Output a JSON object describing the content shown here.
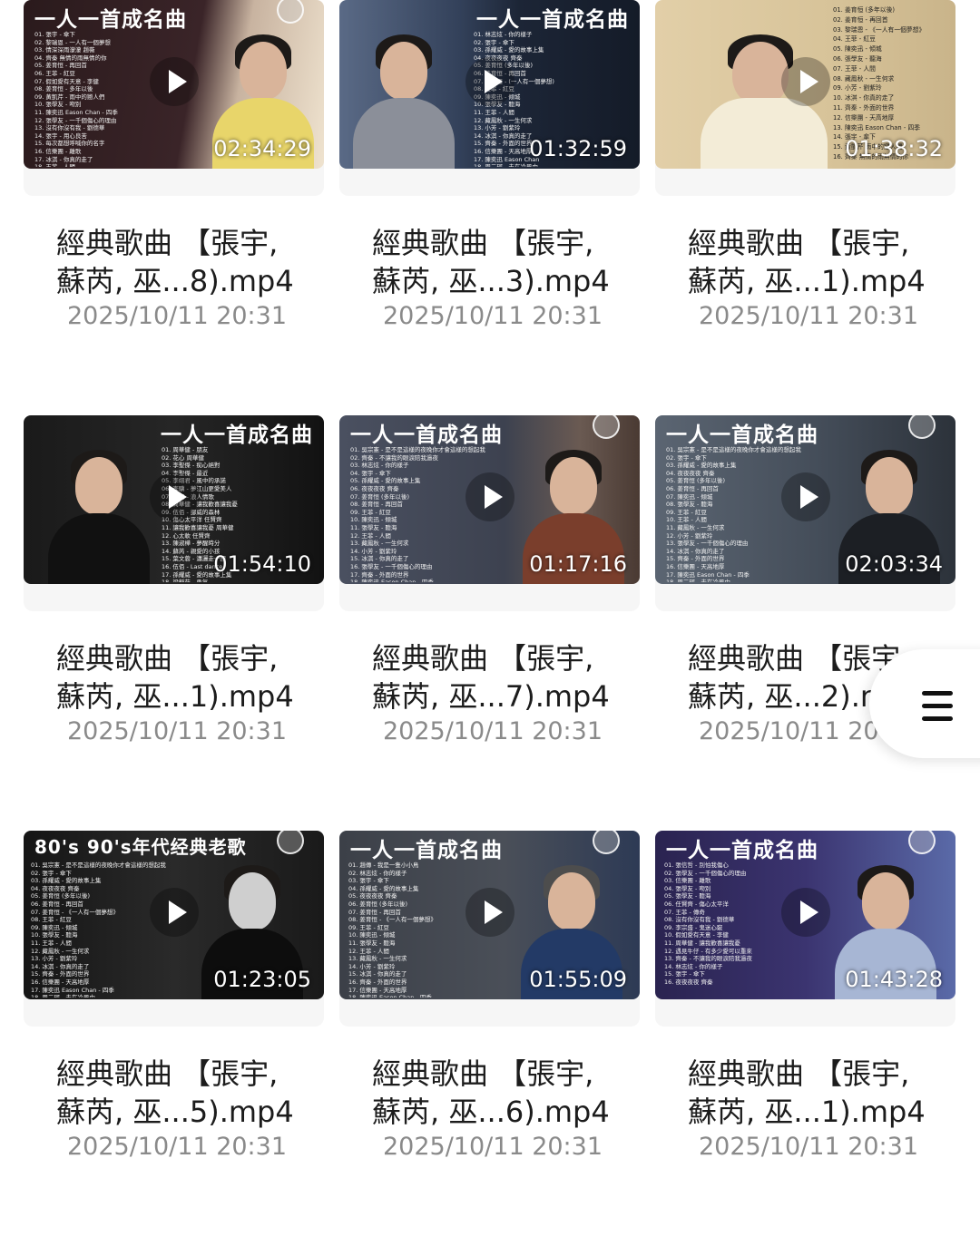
{
  "videos": [
    {
      "thumb_title": "一人一首成名曲",
      "duration": "02:34:29",
      "name_line1": "經典歌曲 【張宇,",
      "name_line2": "蘇芮, 巫...8).mp4",
      "date": "2025/10/11 20:31"
    },
    {
      "thumb_title": "一人一首成名曲",
      "duration": "01:32:59",
      "name_line1": "經典歌曲 【張宇,",
      "name_line2": "蘇芮, 巫...3).mp4",
      "date": "2025/10/11 20:31"
    },
    {
      "thumb_title": "",
      "duration": "01:38:32",
      "name_line1": "經典歌曲 【張宇,",
      "name_line2": "蘇芮, 巫...1).mp4",
      "date": "2025/10/11 20:31"
    },
    {
      "thumb_title": "一人一首成名曲",
      "duration": "01:54:10",
      "name_line1": "經典歌曲 【張宇,",
      "name_line2": "蘇芮, 巫...1).mp4",
      "date": "2025/10/11 20:31"
    },
    {
      "thumb_title": "一人一首成名曲",
      "duration": "01:17:16",
      "name_line1": "經典歌曲 【張宇,",
      "name_line2": "蘇芮, 巫...7).mp4",
      "date": "2025/10/11 20:31"
    },
    {
      "thumb_title": "一人一首成名曲",
      "duration": "02:03:34",
      "name_line1": "經典歌曲 【張宇",
      "name_line2": "蘇芮, 巫...2).m",
      "date": "2025/10/11 20"
    },
    {
      "thumb_title": "80's 90's年代经典老歌",
      "duration": "01:23:05",
      "name_line1": "經典歌曲 【張宇,",
      "name_line2": "蘇芮, 巫...5).mp4",
      "date": "2025/10/11 20:31"
    },
    {
      "thumb_title": "一人一首成名曲",
      "duration": "01:55:09",
      "name_line1": "經典歌曲 【張宇,",
      "name_line2": "蘇芮, 巫...6).mp4",
      "date": "2025/10/11 20:31"
    },
    {
      "thumb_title": "一人一首成名曲",
      "duration": "01:43:28",
      "name_line1": "經典歌曲 【張宇,",
      "name_line2": "蘇芮, 巫...1).mp4",
      "date": "2025/10/11 20:31"
    }
  ],
  "tracklists": {
    "t1": "01. 張宇 - 傘下\n02. 黎瑞恩 - 一人有一個夢想\n03. 情深深雨濛濛 趙薇\n04. 齊秦 無情的雨無情的你\n05. 姜育恒 - 再回首\n06. 王菲 - 紅豆\n07. 假如愛有天意 - 李健\n08. 姜育恒 - 多年以後\n09. 黃凱芹 - 雨中的戀人們\n10. 張學友 - 吻別\n11. 陳奕迅 Eason Chan - 四季\n12. 張學友 - 一千個傷心的理由\n13. 沒有你沒有我 - 劉德華\n14. 張宇 - 用心良苦\n15. 每次都想呼喊你的名字\n16. 信樂團 - 離歌\n17. 冰淇 - 你真的走了\n18. 王菲 - 人間",
    "t2": "01. 林志炫 - 你的樣子\n02. 張宇 - 傘下\n03. 孫耀威 - 愛的故事上集\n04. 夜夜夜夜 齊秦\n05. 姜育恒 (多年以後)\n06. 姜育恒 - 再回首\n07. 姜育恒 - (一人有一個夢想)\n08. 王菲 - 紅豆\n09. 陳奕迅 - 傾城\n10. 張學友 - 聽海\n11. 王菲 - 人間\n12. 藏鳳秋 - 一生何求\n13. 小芳 - 劉紫玲\n14. 冰淇 - 你真的走了\n15. 齊秦 - 外面的世界\n16. 信樂團 - 天高地厚\n17. 陳奕迅 Eason Chan\n18. 周二珂 - 走在冷風中\n19. 齊秦 - 外面的世界\n20. 齊秦 無情的雨無情的你",
    "t3": "01. 姜育恒 (多年以後)\n02. 姜育恒 - 再回首\n03. 黎瑞恩 - 《一人有一個夢想》\n04. 王菲 - 紅豆\n05. 陳奕迅 - 傾城\n06. 張學友 - 聽海\n07. 王菲 - 人間\n08. 藏鳳秋 - 一生何求\n09. 小芳 - 劉紫玲\n10. 冰淇 - 你真的走了\n11. 齊秦 - 外面的世界\n12. 信樂團 - 天高地厚\n13. 陳奕迅 Eason Chan - 四季\n14. 張宇 - 傘下\n15. 黃凱芹 雨中的戀人們\n16. 齊秦 無情的雨無情的你",
    "t4": "01. 周華健 - 朋友\n02. 花心 周華健\n03. 李聖傑 - 痴心絕對\n04. 李聖傑 - 最近\n05. 李翊君 - 風中的承諾\n06. 李驥 - 夢江山更愛美人\n07. 伍佰 - 浪人情歌\n08. 周華健 - 讓我歡喜讓我憂\n09. 伍佰 - 挪威的森林\n10. 傷心太平洋 任賢齊\n11. 讓我歡喜讓我憂 周華健\n12. 心太軟 任賢齊\n13. 陳淑樺 - 夢醒時分\n14. 蘇芮 - 親愛的小孩\n15. 葉文蓉 - 瀟灑走一回\n16. 伍佰 - Last dance\n17. 孫耀威 - 愛的故事上集\n18. 梁靜茹 - 勇氣\n19. 任賢齊 - 天涯",
    "t5": "01. 吳宗憲 - 是不是這樣的夜晚你才會這樣的想起我\n02. 齊秦 - 不讓我的眼淚陪我過夜\n03. 林志炫 - 你的樣子\n04. 張宇 - 傘下\n05. 孫耀威 - 愛的故事上集\n06. 夜夜夜夜 齊秦\n07. 姜育恒 (多年以後)\n08. 姜育恒 - 再回首\n09. 王菲 - 紅豆\n10. 陳奕迅 - 傾城\n11. 張學友 - 聽海\n12. 王菲 - 人間\n13. 藏鳳秋 - 一生何求\n14. 小芳 - 劉紫玲\n15. 冰淇 - 你真的走了\n16. 張學友 - 一千個傷心的理由\n17. 齊秦 - 外面的世界\n18. 陳奕迅 Eason Chan - 四季\n19. 周二珂 - 走在冷風中\n20. 黃凱芹 雨中的戀人們",
    "t6": "01. 吳宗憲 - 是不是這樣的夜晚你才會這樣的想起我\n02. 張宇 - 傘下\n03. 孫耀威 - 愛的故事上集\n04. 夜夜夜夜 齊秦\n05. 姜育恒 (多年以後)\n06. 姜育恒 - 再回首\n07. 陳奕迅 - 傾城\n08. 張學友 - 聽海\n09. 王菲 - 紅豆\n10. 王菲 - 人間\n11. 藏鳳秋 - 一生何求\n12. 小芳 - 劉紫玲\n13. 張學友 - 一千個傷心的理由\n14. 冰淇 - 你真的走了\n15. 齊秦 - 外面的世界\n16. 信樂團 - 天高地厚\n17. 陳奕迅 Eason Chan - 四季\n18. 周二珂 - 走在冷風中\n19. 齊秦 無情的雨無情的你\n20. 情深深雨濛濛 趙薇",
    "t7": "01. 吳宗憲 - 是不是這樣的夜晚你才會這樣的想起我\n02. 張宇 - 傘下\n03. 孫耀威 - 愛的故事上集\n04. 夜夜夜夜 齊秦\n05. 姜育恒 (多年以後)\n06. 姜育恒 - 再回首\n07. 姜育恒 - 《一人有一個夢想》\n08. 王菲 - 紅豆\n09. 陳奕迅 - 傾城\n10. 張學友 - 聽海\n11. 王菲 - 人間\n12. 藏鳳秋 - 一生何求\n13. 小芳 - 劉紫玲\n14. 冰淇 - 你真的走了\n15. 齊秦 - 外面的世界\n16. 信樂團 - 天高地厚\n17. 陳奕迅 Eason Chan - 四季\n18. 周二珂 - 走在冷風中\n19. 黃凱芹 雨中的戀人們\n20. 齊秦 無情的雨無情的你",
    "t8": "01. 趙傳 - 我是一隻小小鳥\n02. 林志炫 - 你的樣子\n03. 張宇 - 傘下\n04. 孫耀威 - 愛的故事上集\n05. 夜夜夜夜 齊秦\n06. 姜育恒 (多年以後)\n07. 姜育恒 - 再回首\n08. 姜育恒 - 《一人有一個夢想》\n09. 王菲 - 紅豆\n10. 陳奕迅 - 傾城\n11. 張學友 - 聽海\n12. 王菲 - 人間\n13. 藏鳳秋 - 一生何求\n14. 小芳 - 劉紫玲\n15. 冰淇 - 你真的走了\n16. 齊秦 - 外面的世界\n17. 信樂團 - 天高地厚\n18. 陳奕迅 Eason Chan - 四季\n19. 周二珂 - 走在冷風中\n20. 黃凱芹 雨中的戀人們",
    "t9": "01. 張信哲 - 別怕我傷心\n02. 張學友 - 一千個傷心的理由\n03. 信樂團 - 離歌\n04. 張學友 - 吻別\n05. 張學友 - 聽海\n06. 任賢齊 - 傷心太平洋\n07. 王菲 - 傳奇\n08. 沒有你沒有我 - 劉德華\n09. 李宗盛 - 鬼迷心竅\n10. 假如愛有天意 - 李健\n11. 周華健 - 讓我歡喜讓我憂\n12. 遇見牛仔 - 有多少愛可以重來\n13. 齊秦 - 不讓我的眼淚陪我過夜\n14. 林志炫 - 你的樣子\n15. 張宇 - 傘下\n16. 夜夜夜夜 齊秦"
  },
  "colors": {
    "date_text": "#8a8a8a",
    "name_text": "#1c1c1c"
  },
  "icons": {
    "menu": "hamburger-menu-icon",
    "play": "play-icon",
    "select": "select-circle-icon"
  }
}
